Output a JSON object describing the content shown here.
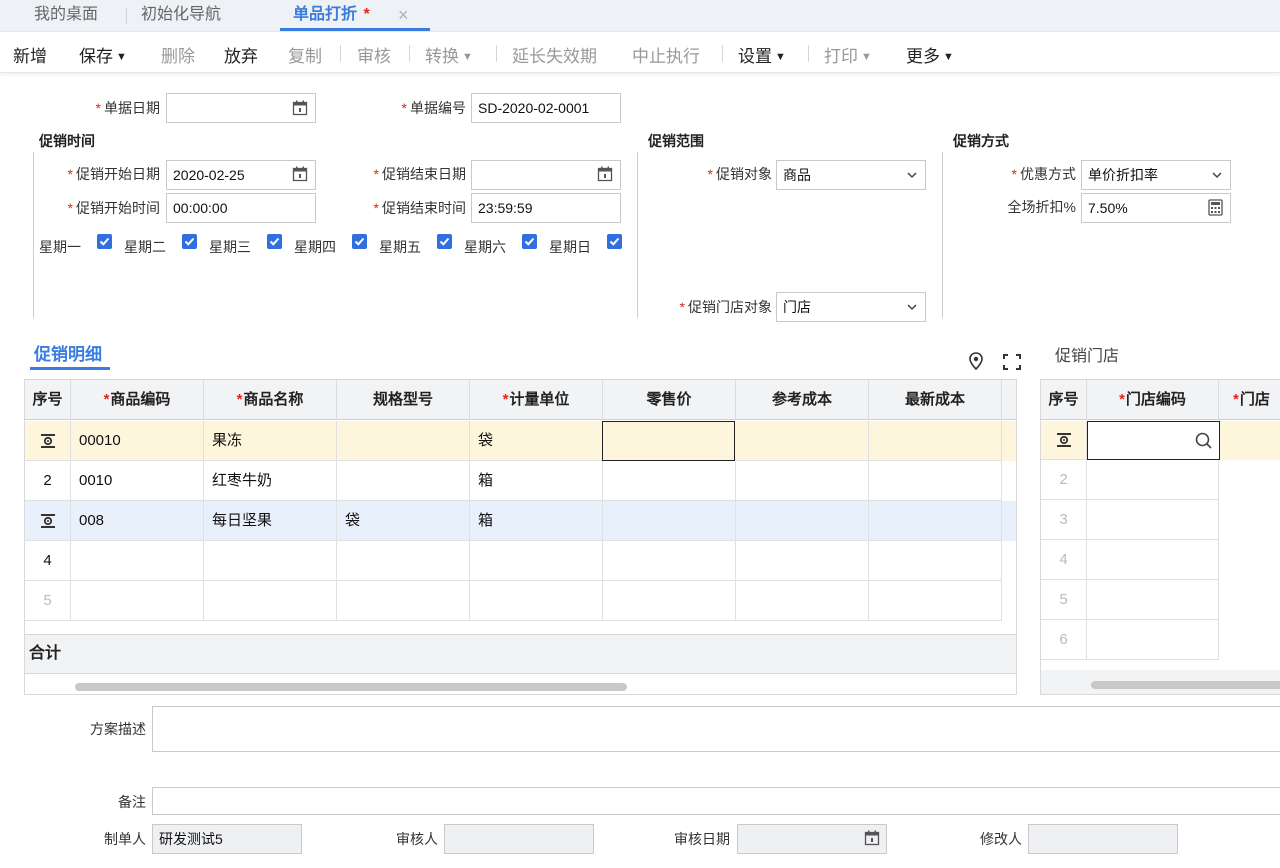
{
  "tabs": {
    "desktop": "我的桌面",
    "init_nav": "初始化导航",
    "active": "单品打折",
    "active_mark": "*",
    "close": "×"
  },
  "toolbar": {
    "new": "新增",
    "save": "保存",
    "delete": "删除",
    "discard": "放弃",
    "copy": "复制",
    "audit": "审核",
    "convert": "转换",
    "extend": "延长失效期",
    "stop": "中止执行",
    "settings": "设置",
    "print": "打印",
    "more": "更多"
  },
  "header": {
    "doc_date_label": "单据日期",
    "doc_date_value": "",
    "doc_no_label": "单据编号",
    "doc_no_value": "SD-2020-02-0001"
  },
  "promo_time": {
    "title": "促销时间",
    "start_date_label": "促销开始日期",
    "start_date_value": "2020-02-25",
    "end_date_label": "促销结束日期",
    "end_date_value": "",
    "start_time_label": "促销开始时间",
    "start_time_value": "00:00:00",
    "end_time_label": "促销结束时间",
    "end_time_value": "23:59:59",
    "weekdays": [
      {
        "label": "星期一",
        "checked": true
      },
      {
        "label": "星期二",
        "checked": true
      },
      {
        "label": "星期三",
        "checked": true
      },
      {
        "label": "星期四",
        "checked": true
      },
      {
        "label": "星期五",
        "checked": true
      },
      {
        "label": "星期六",
        "checked": true
      },
      {
        "label": "星期日",
        "checked": true
      }
    ]
  },
  "promo_scope": {
    "title": "促销范围",
    "target_label": "促销对象",
    "target_value": "商品",
    "store_target_label": "促销门店对象",
    "store_target_value": "门店"
  },
  "promo_method": {
    "title": "促销方式",
    "discount_type_label": "优惠方式",
    "discount_type_value": "单价折扣率",
    "all_discount_label": "全场折扣%",
    "all_discount_value": "7.50%"
  },
  "detail": {
    "tab_label": "促销明细",
    "columns": [
      "序号",
      "商品编码",
      "商品名称",
      "规格型号",
      "计量单位",
      "零售价",
      "参考成本",
      "最新成本"
    ],
    "required_cols": [
      false,
      true,
      true,
      false,
      true,
      false,
      false,
      false
    ],
    "rows": [
      {
        "no": "",
        "code": "00010",
        "name": "果冻",
        "spec": "",
        "unit": "袋",
        "price": "",
        "ref_cost": "",
        "new_cost": ""
      },
      {
        "no": "2",
        "code": "0010",
        "name": "红枣牛奶",
        "spec": "",
        "unit": "箱",
        "price": "",
        "ref_cost": "",
        "new_cost": ""
      },
      {
        "no": "",
        "code": "008",
        "name": "每日坚果",
        "spec": "袋",
        "unit": "箱",
        "price": "",
        "ref_cost": "",
        "new_cost": ""
      },
      {
        "no": "4",
        "code": "",
        "name": "",
        "spec": "",
        "unit": "",
        "price": "",
        "ref_cost": "",
        "new_cost": ""
      },
      {
        "no": "5",
        "code": "",
        "name": "",
        "spec": "",
        "unit": "",
        "price": "",
        "ref_cost": "",
        "new_cost": ""
      }
    ],
    "total_label": "合计"
  },
  "stores": {
    "title": "促销门店",
    "columns": [
      "序号",
      "门店编码",
      "门店"
    ],
    "required_cols": [
      false,
      true,
      true
    ],
    "rows": [
      "",
      "2",
      "3",
      "4",
      "5",
      "6"
    ]
  },
  "footer": {
    "plan_desc_label": "方案描述",
    "remark_label": "备注",
    "creator_label": "制单人",
    "creator_value": "研发测试5",
    "auditor_label": "审核人",
    "auditor_value": "",
    "audit_date_label": "审核日期",
    "audit_date_value": "",
    "modifier_label": "修改人",
    "modifier_value": ""
  },
  "colors": {
    "accent": "#3a7de0",
    "required": "#e2231a",
    "checkbox": "#2f6fe0",
    "selected_row": "#fdf5dc",
    "highlight_row": "#e8f0fb"
  }
}
